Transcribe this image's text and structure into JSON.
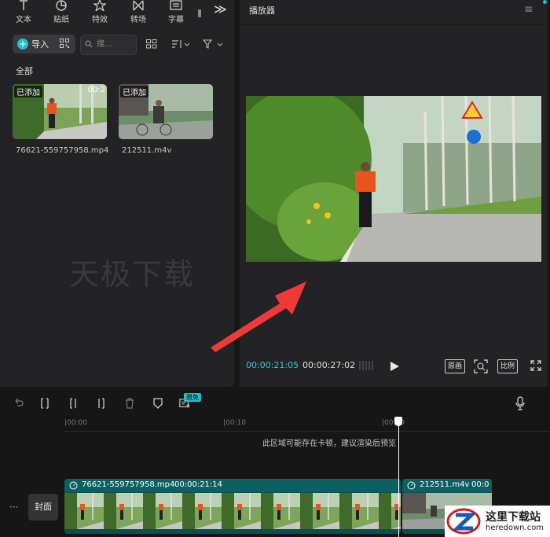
{
  "top_tabs": [
    {
      "label": "文本",
      "icon": "text-icon"
    },
    {
      "label": "贴纸",
      "icon": "sticker-icon"
    },
    {
      "label": "特效",
      "icon": "effects-icon"
    },
    {
      "label": "转场",
      "icon": "transition-icon"
    },
    {
      "label": "字幕",
      "icon": "subtitle-icon"
    }
  ],
  "tabs_more": "≫",
  "media": {
    "import_label": "导入",
    "search_placeholder": "搜...",
    "all_label": "全部",
    "clips": [
      {
        "name": "76621-559757958.mp4",
        "badge": "已添加",
        "duration": "00:2"
      },
      {
        "name": "212511.m4v",
        "badge": "已添加",
        "duration": ""
      }
    ],
    "watermark": "天极下载"
  },
  "player": {
    "title": "播放器",
    "time_current": "00:00:21:05",
    "time_total": "00:00:27:02",
    "btn_original": "原画",
    "btn_ratio": "比例"
  },
  "toolbar": {
    "free_badge": "限免"
  },
  "timeline": {
    "ticks": [
      "|00:00",
      "|00:10",
      "|00:20"
    ],
    "hint": "此区域可能存在卡顿，建议渲染后预览",
    "track_more": "···",
    "cover_label": "封面",
    "clip_a": {
      "name": "76621-559757958.mp4",
      "duration": "00:00:21:14"
    },
    "clip_b": {
      "name": "212511.m4v",
      "duration": "00:0"
    }
  },
  "site_logo": {
    "name": "这里下载站",
    "domain": "heredown.com"
  },
  "colors": {
    "accent": "#1ec0cf",
    "panel": "#232325",
    "clip": "#0d4f51",
    "arrow": "#f03a3a"
  }
}
